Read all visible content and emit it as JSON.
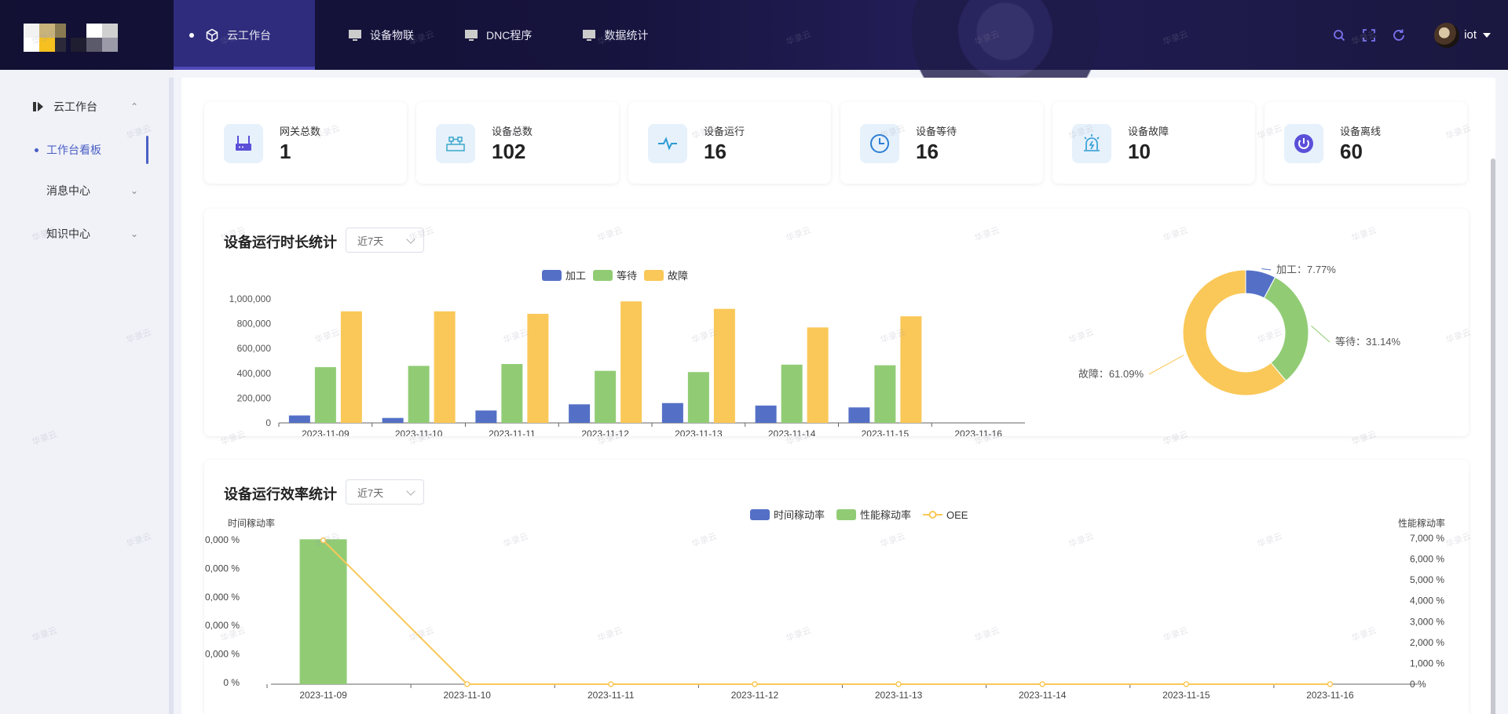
{
  "header": {
    "nav": [
      {
        "label": "云工作台",
        "icon": "cube-icon",
        "active": true
      },
      {
        "label": "设备物联",
        "icon": "monitor-icon"
      },
      {
        "label": "DNC程序",
        "icon": "monitor-icon"
      },
      {
        "label": "数据统计",
        "icon": "monitor-icon"
      }
    ],
    "user": "iot",
    "tools": [
      "search-icon",
      "fullscreen-icon",
      "refresh-icon"
    ]
  },
  "sidebar": {
    "group": "云工作台",
    "active_item": "工作台看板",
    "items": [
      {
        "label": "消息中心"
      },
      {
        "label": "知识中心"
      }
    ]
  },
  "stats": [
    {
      "label": "网关总数",
      "value": "1",
      "icon": "gateway-icon"
    },
    {
      "label": "设备总数",
      "value": "102",
      "icon": "device-icon"
    },
    {
      "label": "设备运行",
      "value": "16",
      "icon": "pulse-icon"
    },
    {
      "label": "设备等待",
      "value": "16",
      "icon": "clock-icon"
    },
    {
      "label": "设备故障",
      "value": "10",
      "icon": "alarm-icon"
    },
    {
      "label": "设备离线",
      "value": "60",
      "icon": "power-icon"
    }
  ],
  "runtime_panel": {
    "title": "设备运行时长统计",
    "select": "近7天"
  },
  "efficiency_panel": {
    "title": "设备运行效率统计",
    "select": "近7天"
  },
  "watermark": "华录云",
  "colors": {
    "blue": "#5470c6",
    "green": "#91cc75",
    "yellow": "#fac858",
    "accent": "#4b5fc4"
  },
  "chart_data": [
    {
      "type": "bar",
      "categories": [
        "2023-11-09",
        "2023-11-10",
        "2023-11-11",
        "2023-11-12",
        "2023-11-13",
        "2023-11-14",
        "2023-11-15",
        "2023-11-16"
      ],
      "series": [
        {
          "name": "加工",
          "values": [
            60000,
            40000,
            100000,
            150000,
            160000,
            140000,
            125000,
            0
          ]
        },
        {
          "name": "等待",
          "values": [
            450000,
            460000,
            475000,
            420000,
            410000,
            470000,
            465000,
            0
          ]
        },
        {
          "name": "故障",
          "values": [
            900000,
            900000,
            880000,
            980000,
            920000,
            770000,
            860000,
            0
          ]
        }
      ],
      "yticks": [
        "0",
        "200,000",
        "400,000",
        "600,000",
        "800,000",
        "1,000,000"
      ],
      "ylim": [
        0,
        1000000
      ],
      "legend": "top-center"
    },
    {
      "type": "pie",
      "labels": [
        "加工：7.77%",
        "等待：31.14%",
        "故障：61.09%"
      ],
      "values": [
        7.77,
        31.14,
        61.09
      ]
    },
    {
      "type": "bar",
      "categories": [
        "2023-11-09",
        "2023-11-10",
        "2023-11-11",
        "2023-11-12",
        "2023-11-13",
        "2023-11-14",
        "2023-11-15",
        "2023-11-16"
      ],
      "series": [
        {
          "name": "时间稼动率",
          "values": [
            0,
            0,
            0,
            0,
            0,
            0,
            0,
            0
          ]
        },
        {
          "name": "性能稼动率",
          "values": [
            6950,
            0,
            0,
            0,
            0,
            0,
            0,
            0
          ]
        },
        {
          "name": "OEE",
          "values": [
            6900,
            0,
            0,
            0,
            0,
            0,
            0,
            0
          ]
        }
      ],
      "ylabel": "时间稼动率",
      "y2label": "性能稼动率",
      "yticks_left": [
        "0 %",
        "0,000 %",
        "0,000 %",
        "0,000 %",
        "0,000 %",
        "0,000 %"
      ],
      "yticks_right": [
        "0 %",
        "1,000 %",
        "2,000 %",
        "3,000 %",
        "4,000 %",
        "5,000 %",
        "6,000 %",
        "7,000 %"
      ],
      "y2lim": [
        0,
        7000
      ],
      "legend": "top-center"
    }
  ]
}
